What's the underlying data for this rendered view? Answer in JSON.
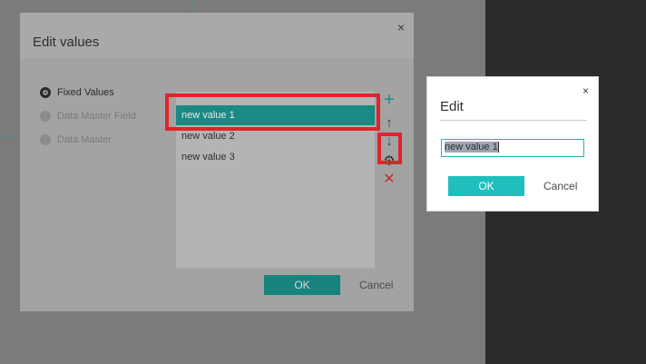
{
  "main_dialog": {
    "title": "Edit values",
    "close_glyph": "×",
    "options": [
      {
        "label": "Fixed Values",
        "selected": true
      },
      {
        "label": "Data Master Field",
        "selected": false
      },
      {
        "label": "Data Master",
        "selected": false
      }
    ],
    "values": [
      "new value 1",
      "new value 2",
      "new value 3"
    ],
    "selected_index": 0,
    "tools": {
      "add": "+",
      "up": "↑",
      "down": "↓",
      "settings": "⚙",
      "delete": "✕"
    },
    "ok_label": "OK",
    "cancel_label": "Cancel"
  },
  "edit_dialog": {
    "title": "Edit",
    "close_glyph": "×",
    "input_value": "new value 1",
    "ok_label": "OK",
    "cancel_label": "Cancel"
  },
  "colors": {
    "accent": "#1a8a84",
    "accent_light": "#20bfbe",
    "highlight": "#e0242b",
    "delete": "#c22d2d"
  }
}
